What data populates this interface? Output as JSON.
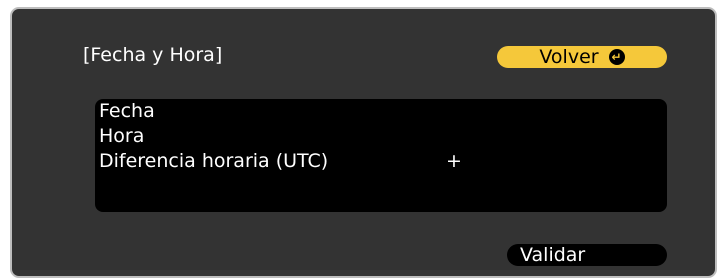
{
  "dialog": {
    "title": "[Fecha y Hora]",
    "back_label": "Volver",
    "back_icon": "enter-icon",
    "validate_label": "Validar"
  },
  "menu": {
    "items": [
      {
        "label": "Fecha",
        "value": ""
      },
      {
        "label": "Hora",
        "value": ""
      },
      {
        "label": "Diferencia horaria (UTC)",
        "value": "+"
      },
      {
        "label": "",
        "value": ""
      }
    ]
  },
  "colors": {
    "panel_bg": "#333333",
    "list_bg": "#000000",
    "accent_yellow": "#f5c83a",
    "text": "#ffffff"
  }
}
